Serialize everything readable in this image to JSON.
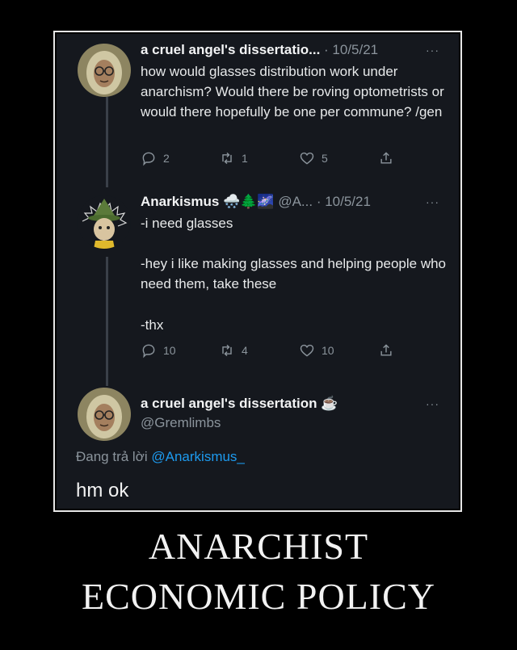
{
  "tweets": [
    {
      "display_name": "a cruel angel's dissertatio...",
      "meta": "· 10/5/21",
      "more": "···",
      "text": "how would glasses distribution work under anarchism? Would there be roving optometrists or would there hopefully be one per commune? /gen",
      "replies": "2",
      "retweets": "1",
      "likes": "5"
    },
    {
      "display_name": "Anarkismus",
      "emoji": "🌨️🌲🌌",
      "handle": "@A...",
      "meta": "· 10/5/21",
      "more": "···",
      "lines": [
        "-i need glasses",
        "-hey i like making glasses and helping people who need them, take these",
        "-thx"
      ],
      "replies": "10",
      "retweets": "4",
      "likes": "10"
    }
  ],
  "composer": {
    "display_name": "a cruel angel's dissertation",
    "emoji": "☕",
    "handle": "@Gremlimbs",
    "more": "···",
    "replying_prefix": "Đang trả lời",
    "replying_to": "@Anarkismus_",
    "text": "hm ok"
  },
  "caption": {
    "line1": "ANARCHIST",
    "line2": "ECONOMIC POLICY"
  },
  "colors": {
    "background": "#000000",
    "screen": "#15181e",
    "link": "#1d9bf0",
    "muted": "#8b949c"
  }
}
